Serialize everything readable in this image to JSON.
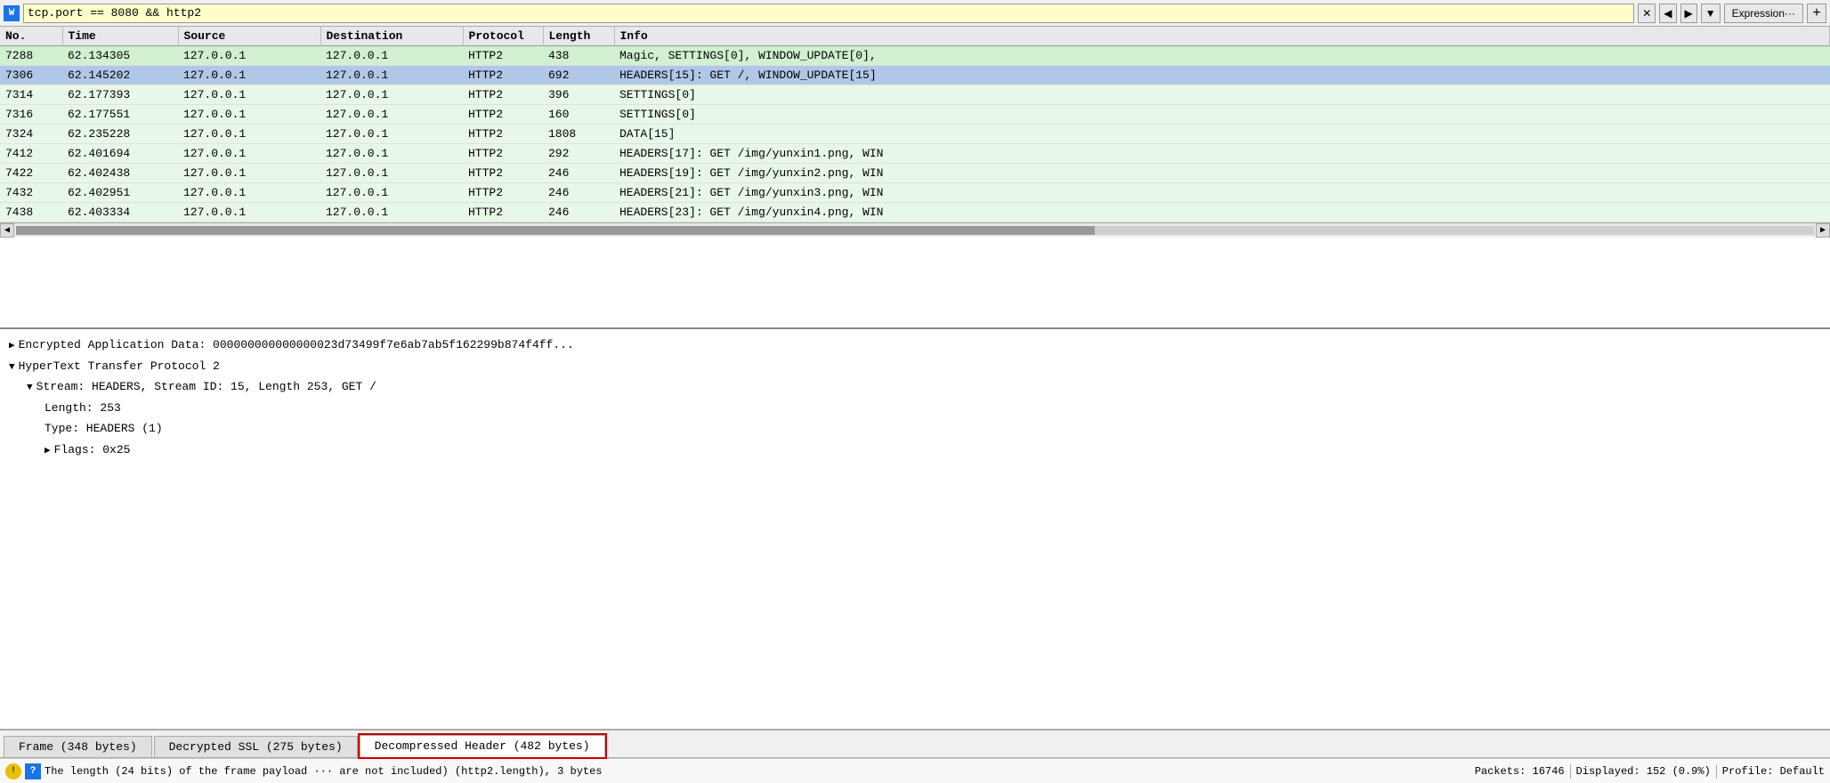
{
  "filter_bar": {
    "icon_label": "W",
    "filter_value": "tcp.port == 8080 && http2",
    "btn_clear_label": "✕",
    "btn_left_label": "◀",
    "btn_right_label": "▶",
    "btn_dropdown_label": "▼",
    "expression_label": "Expression···",
    "plus_label": "+"
  },
  "packet_table": {
    "columns": [
      "No.",
      "Time",
      "Source",
      "Destination",
      "Protocol",
      "Length",
      "Info"
    ],
    "rows": [
      {
        "no": "7288",
        "time": "62.134305",
        "src": "127.0.0.1",
        "dst": "127.0.0.1",
        "proto": "HTTP2",
        "len": "438",
        "info": "Magic, SETTINGS[0], WINDOW_UPDATE[0],",
        "style": "green"
      },
      {
        "no": "7306",
        "time": "62.145202",
        "src": "127.0.0.1",
        "dst": "127.0.0.1",
        "proto": "HTTP2",
        "len": "692",
        "info": "HEADERS[15]: GET /, WINDOW_UPDATE[15]",
        "style": "selected"
      },
      {
        "no": "7314",
        "time": "62.177393",
        "src": "127.0.0.1",
        "dst": "127.0.0.1",
        "proto": "HTTP2",
        "len": "396",
        "info": "SETTINGS[0]",
        "style": "light-green"
      },
      {
        "no": "7316",
        "time": "62.177551",
        "src": "127.0.0.1",
        "dst": "127.0.0.1",
        "proto": "HTTP2",
        "len": "160",
        "info": "SETTINGS[0]",
        "style": "light-green"
      },
      {
        "no": "7324",
        "time": "62.235228",
        "src": "127.0.0.1",
        "dst": "127.0.0.1",
        "proto": "HTTP2",
        "len": "1808",
        "info": "DATA[15]",
        "style": "light-green"
      },
      {
        "no": "7412",
        "time": "62.401694",
        "src": "127.0.0.1",
        "dst": "127.0.0.1",
        "proto": "HTTP2",
        "len": "292",
        "info": "HEADERS[17]: GET /img/yunxin1.png, WIN",
        "style": "light-green"
      },
      {
        "no": "7422",
        "time": "62.402438",
        "src": "127.0.0.1",
        "dst": "127.0.0.1",
        "proto": "HTTP2",
        "len": "246",
        "info": "HEADERS[19]: GET /img/yunxin2.png, WIN",
        "style": "light-green"
      },
      {
        "no": "7432",
        "time": "62.402951",
        "src": "127.0.0.1",
        "dst": "127.0.0.1",
        "proto": "HTTP2",
        "len": "246",
        "info": "HEADERS[21]: GET /img/yunxin3.png, WIN",
        "style": "light-green"
      },
      {
        "no": "7438",
        "time": "62.403334",
        "src": "127.0.0.1",
        "dst": "127.0.0.1",
        "proto": "HTTP2",
        "len": "246",
        "info": "HEADERS[23]: GET /img/yunxin4.png, WIN",
        "style": "light-green"
      }
    ]
  },
  "detail_pane": {
    "line1": "Encrypted Application Data: 000000000000000023d73499f7e6ab7ab5f162299b874f4ff...",
    "line2": "HyperText Transfer Protocol 2",
    "line3": "Stream: HEADERS, Stream ID: 15, Length 253, GET /",
    "line4_highlighted": "Length: 253",
    "line5": "Type: HEADERS (1)",
    "line6": "Flags: 0x25"
  },
  "bottom_tabs": [
    {
      "label": "Frame (348 bytes)",
      "active": false
    },
    {
      "label": "Decrypted SSL (275 bytes)",
      "active": false
    },
    {
      "label": "Decompressed Header (482 bytes)",
      "active": true,
      "highlighted": true
    }
  ],
  "status_bar": {
    "warning_icon": "!",
    "info_icon": "?",
    "main_text": "The length (24 bits) of the frame payload ··· are not included) (http2.length), 3 bytes",
    "packets_label": "Packets: 16746",
    "displayed_label": "Displayed: 152 (0.9%)",
    "profile_label": "Profile: Default"
  }
}
